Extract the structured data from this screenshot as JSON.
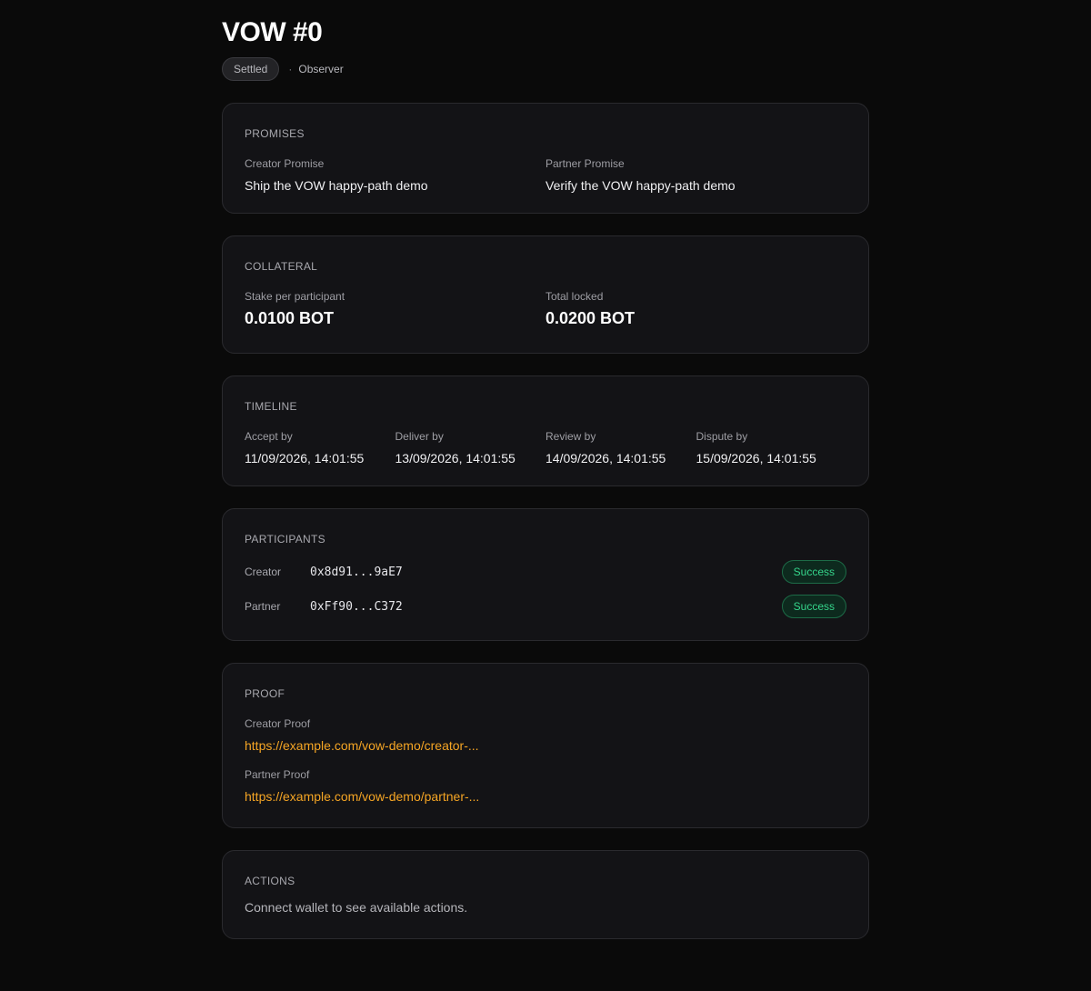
{
  "header": {
    "title": "VOW #0",
    "status": "Settled",
    "separator": "·",
    "role": "Observer"
  },
  "promises": {
    "title": "PROMISES",
    "creator_label": "Creator Promise",
    "creator_value": "Ship the VOW happy-path demo",
    "partner_label": "Partner Promise",
    "partner_value": "Verify the VOW happy-path demo"
  },
  "collateral": {
    "title": "COLLATERAL",
    "stake_label": "Stake per participant",
    "stake_value": "0.0100 BOT",
    "total_label": "Total locked",
    "total_value": "0.0200 BOT"
  },
  "timeline": {
    "title": "TIMELINE",
    "items": [
      {
        "label": "Accept by",
        "value": "11/09/2026, 14:01:55"
      },
      {
        "label": "Deliver by",
        "value": "13/09/2026, 14:01:55"
      },
      {
        "label": "Review by",
        "value": "14/09/2026, 14:01:55"
      },
      {
        "label": "Dispute by",
        "value": "15/09/2026, 14:01:55"
      }
    ]
  },
  "participants": {
    "title": "PARTICIPANTS",
    "rows": [
      {
        "role": "Creator",
        "address": "0x8d91...9aE7",
        "status": "Success"
      },
      {
        "role": "Partner",
        "address": "0xFf90...C372",
        "status": "Success"
      }
    ]
  },
  "proof": {
    "title": "PROOF",
    "creator_label": "Creator Proof",
    "creator_link": "https://example.com/vow-demo/creator-...",
    "partner_label": "Partner Proof",
    "partner_link": "https://example.com/vow-demo/partner-..."
  },
  "actions": {
    "title": "ACTIONS",
    "message": "Connect wallet to see available actions."
  },
  "colors": {
    "background": "#0a0a0a",
    "card": "#131316",
    "success": "#35d58b",
    "link": "#f5a524"
  }
}
